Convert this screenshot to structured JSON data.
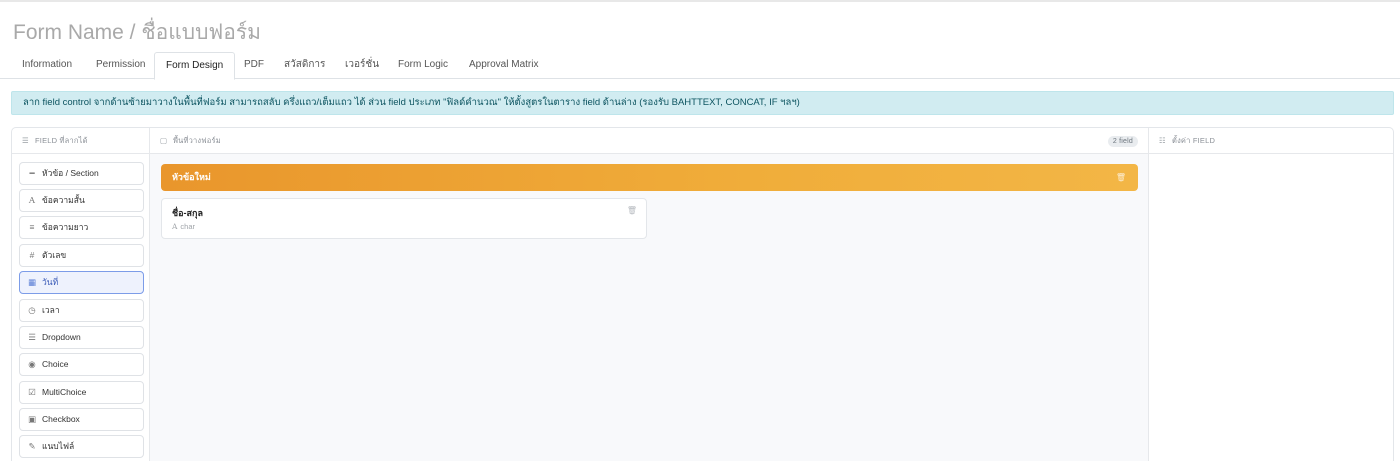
{
  "page": {
    "title": "Form Name / ชื่อแบบฟอร์ม"
  },
  "tabs": [
    {
      "label": "Information",
      "active": false
    },
    {
      "label": "Permission",
      "active": false
    },
    {
      "label": "Form Design",
      "active": true
    },
    {
      "label": "PDF",
      "active": false
    },
    {
      "label": "สวัสดิการ",
      "active": false
    },
    {
      "label": "เวอร์ชั่น",
      "active": false
    },
    {
      "label": "Form Logic",
      "active": false
    },
    {
      "label": "Approval Matrix",
      "active": false
    }
  ],
  "alert": {
    "text": "ลาก field control จากด้านซ้ายมาวางในพื้นที่ฟอร์ม สามารถสลับ ครึ่งแถว/เต็มแถว ได้ ส่วน field ประเภท \"ฟิลด์คำนวณ\" ให้ตั้งสูตรในตาราง field ด้านล่าง (รองรับ BAHTTEXT, CONCAT, IF ฯลฯ)"
  },
  "left_panel": {
    "header": "FIELD ที่ลากได้",
    "header_icon": "list-icon",
    "items": [
      {
        "label": "หัวข้อ / Section",
        "icon": "minus-icon",
        "selected": false
      },
      {
        "label": "ข้อความสั้น",
        "icon": "text-a-icon",
        "selected": false
      },
      {
        "label": "ข้อความยาว",
        "icon": "paragraph-icon",
        "selected": false
      },
      {
        "label": "ตัวเลข",
        "icon": "hash-icon",
        "selected": false
      },
      {
        "label": "วันที่",
        "icon": "calendar-icon",
        "selected": true
      },
      {
        "label": "เวลา",
        "icon": "clock-icon",
        "selected": false
      },
      {
        "label": "Dropdown",
        "icon": "list-icon",
        "selected": false
      },
      {
        "label": "Choice",
        "icon": "radio-icon",
        "selected": false
      },
      {
        "label": "MultiChoice",
        "icon": "checkbox-outline-icon",
        "selected": false
      },
      {
        "label": "Checkbox",
        "icon": "checkbox-checked-icon",
        "selected": false
      },
      {
        "label": "แนบไฟล์",
        "icon": "paperclip-icon",
        "selected": false
      }
    ]
  },
  "middle_panel": {
    "header": "พื้นที่วางฟอร์ม",
    "header_icon": "layout-icon",
    "field_count": "2 field",
    "section": {
      "label": "หัวข้อใหม่",
      "icon": "trash-icon"
    },
    "field_card": {
      "label": "ชื่อ-สกุล",
      "type": "char",
      "type_icon": "text-a-icon",
      "delete_icon": "trash-icon"
    }
  },
  "right_panel": {
    "header": "ตั้งค่า FIELD",
    "header_icon": "sliders-icon"
  },
  "colors": {
    "section_gradient_start": "#e9962c",
    "section_gradient_end": "#f3b646",
    "alert_bg": "#d1ecf1",
    "selected_border": "#7c9ce8"
  }
}
